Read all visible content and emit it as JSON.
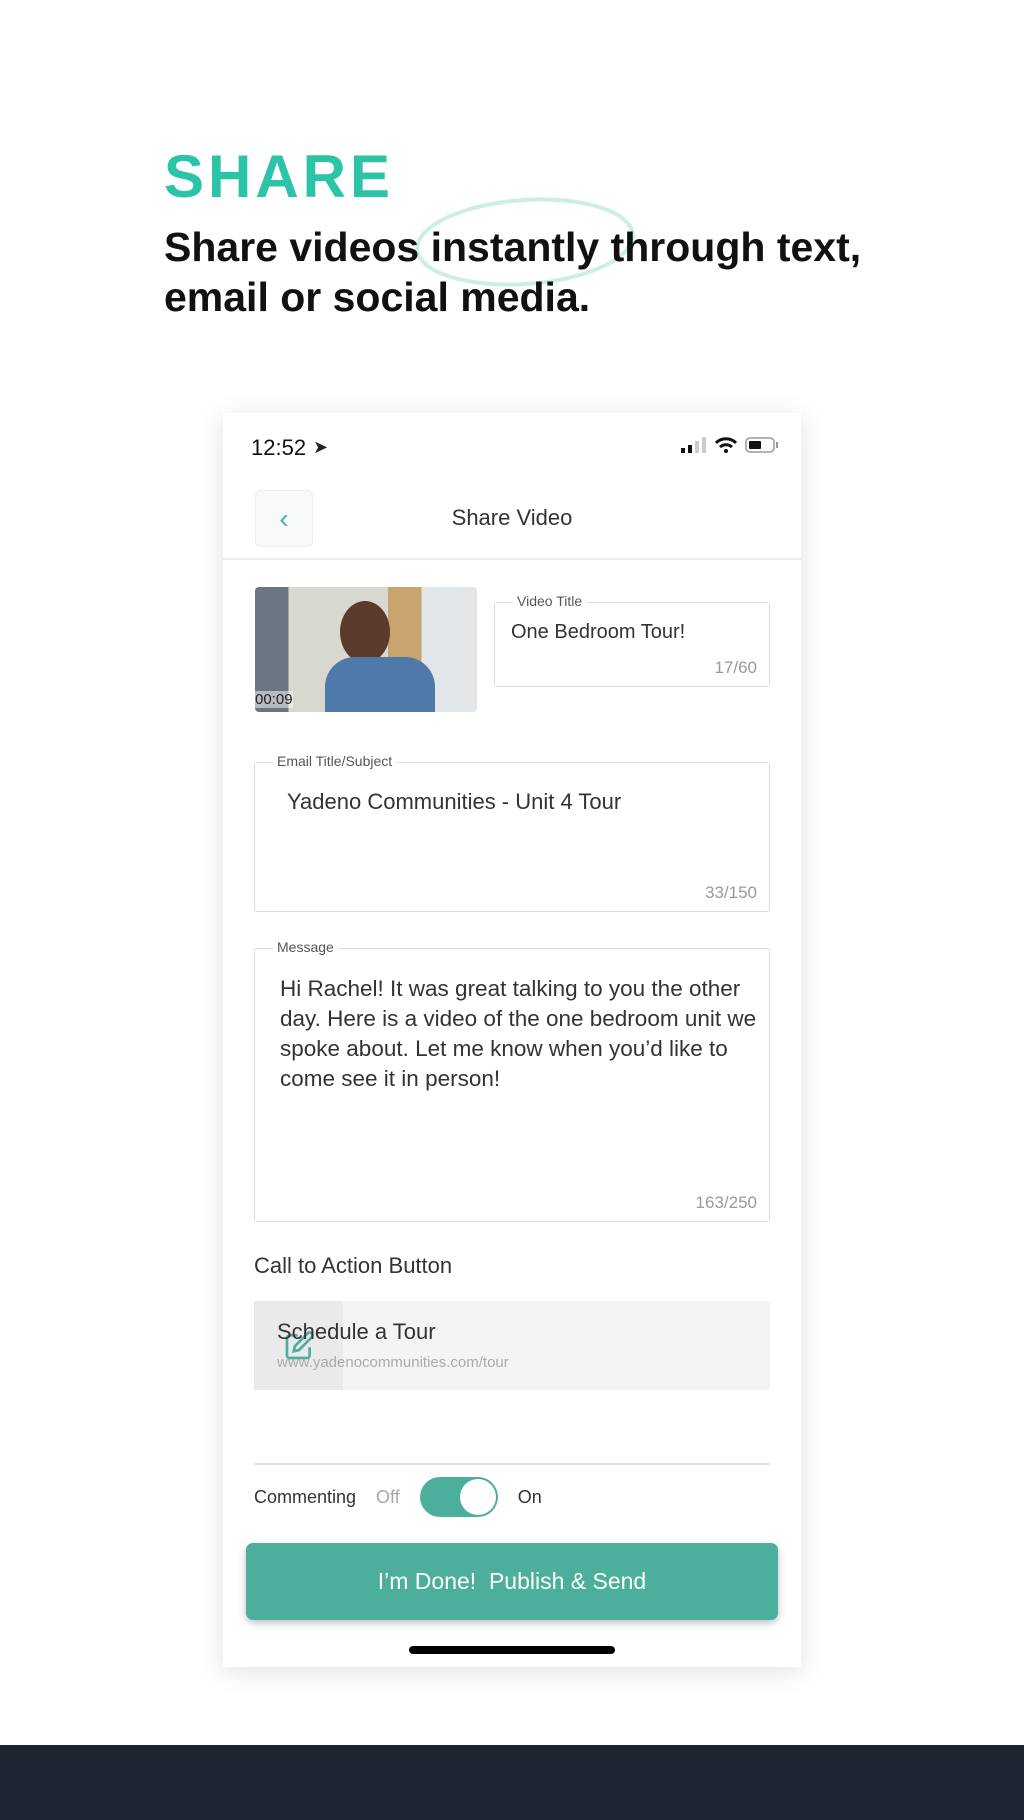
{
  "promo": {
    "heading": "SHARE",
    "subtitle": "Share videos instantly through text, email or social media.",
    "accent": "#2cc4a6"
  },
  "status_bar": {
    "time": "12:52"
  },
  "nav": {
    "title": "Share Video"
  },
  "video": {
    "duration": "00:09"
  },
  "video_title": {
    "label": "Video Title",
    "value": "One Bedroom Tour!",
    "count": "17/60"
  },
  "email_subject": {
    "label": "Email Title/Subject",
    "value": "Yadeno Communities - Unit 4 Tour",
    "count": "33/150"
  },
  "message": {
    "label": "Message",
    "value": "Hi Rachel! It was great talking to you the other day. Here is a video of the one bedroom unit we spoke about. Let me know when you’d like to come see it in person!",
    "count": "163/250"
  },
  "cta": {
    "section_label": "Call to Action Button",
    "title": "Schedule a Tour",
    "url": "www.yadenocommunities.com/tour"
  },
  "commenting": {
    "label": "Commenting",
    "off": "Off",
    "on": "On",
    "enabled": true
  },
  "done_button": "I’m Done!  Publish & Send",
  "button_color": "#4caf9c"
}
